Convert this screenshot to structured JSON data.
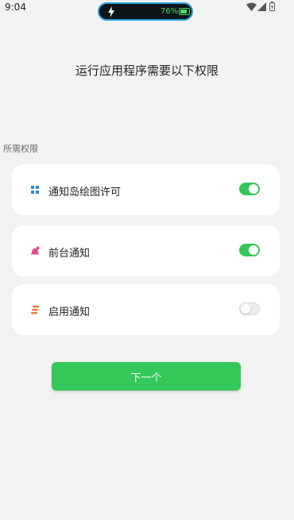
{
  "status_bar": {
    "time": "9:04",
    "battery_percent": "76%",
    "charging": true,
    "icons": [
      "wifi-icon",
      "cellular-signal-icon",
      "battery-icon"
    ]
  },
  "header": {
    "title": "运行应用程序需要以下权限"
  },
  "section": {
    "label": "所需权限"
  },
  "permissions": [
    {
      "label": "通知岛绘图许可",
      "icon": "grid-icon",
      "icon_color": "#2f7fe8",
      "enabled": true
    },
    {
      "label": "前台通知",
      "icon": "bell-icon",
      "icon_color": "#e8458f",
      "enabled": true
    },
    {
      "label": "启用通知",
      "icon": "stack-icon",
      "icon_color": "#f07a3a",
      "enabled": false
    }
  ],
  "next_button": {
    "label": "下一个"
  },
  "colors": {
    "accent": "#34c759",
    "background": "#f2f2f2"
  }
}
